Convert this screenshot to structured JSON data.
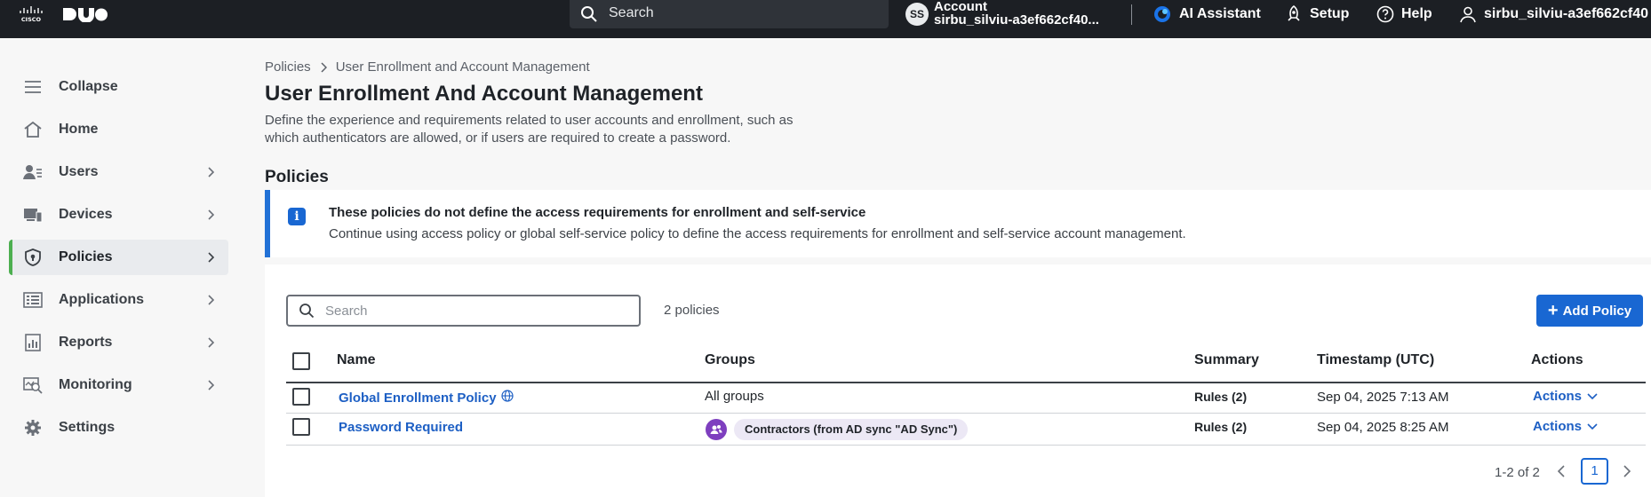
{
  "topbar": {
    "brand_icons": [
      "cisco-logo",
      "duo-logo"
    ],
    "search_label": "Search",
    "account_initials": "SS",
    "account_label": "Account",
    "account_name": "sirbu_silviu-a3ef662cf40...",
    "ai_assistant": "AI Assistant",
    "setup": "Setup",
    "help": "Help",
    "user_name": "sirbu_silviu-a3ef662cf40"
  },
  "sidebar": {
    "items": [
      {
        "label": "Collapse",
        "icon": "menu-icon"
      },
      {
        "label": "Home",
        "icon": "home-icon"
      },
      {
        "label": "Users",
        "icon": "users-icon"
      },
      {
        "label": "Devices",
        "icon": "devices-icon"
      },
      {
        "label": "Policies",
        "icon": "shield-icon"
      },
      {
        "label": "Applications",
        "icon": "applications-icon"
      },
      {
        "label": "Reports",
        "icon": "reports-icon"
      },
      {
        "label": "Monitoring",
        "icon": "monitoring-icon"
      },
      {
        "label": "Settings",
        "icon": "gear-icon"
      }
    ],
    "active": "Policies"
  },
  "breadcrumb": {
    "root": "Policies",
    "current": "User Enrollment and Account Management"
  },
  "page": {
    "title": "User Enrollment And Account Management",
    "description": "Define the experience and requirements related to user accounts and enrollment, such as which authenticators are allowed, or if users are required to create a password.",
    "section_title": "Policies"
  },
  "banner": {
    "title": "These policies do not define the access requirements for enrollment and self-service",
    "text": "Continue using access policy or global self-service policy to define the access requirements for enrollment and self-service account management."
  },
  "table": {
    "search_placeholder": "Search",
    "count": "2 policies",
    "add_button": "Add Policy",
    "columns": [
      "Name",
      "Groups",
      "Summary",
      "Timestamp (UTC)",
      "Actions"
    ],
    "rows": [
      {
        "name": "Global Enrollment Policy",
        "groups": "All groups",
        "summary": "Rules (2)",
        "timestamp": "Sep 04, 2025  7:13 AM",
        "actions": "Actions"
      },
      {
        "name": "Password Required",
        "groups": "Contractors (from AD sync \"AD Sync\")",
        "summary": "Rules (2)",
        "timestamp": "Sep 04, 2025  8:25 AM",
        "actions": "Actions"
      }
    ],
    "pagination": {
      "range": "1-2 of 2",
      "page": "1"
    }
  },
  "colors": {
    "topbar": "#1c1f24",
    "accent": "#1967d2",
    "active_marker": "#4caf50",
    "group_avatar": "#7e3fbf"
  }
}
